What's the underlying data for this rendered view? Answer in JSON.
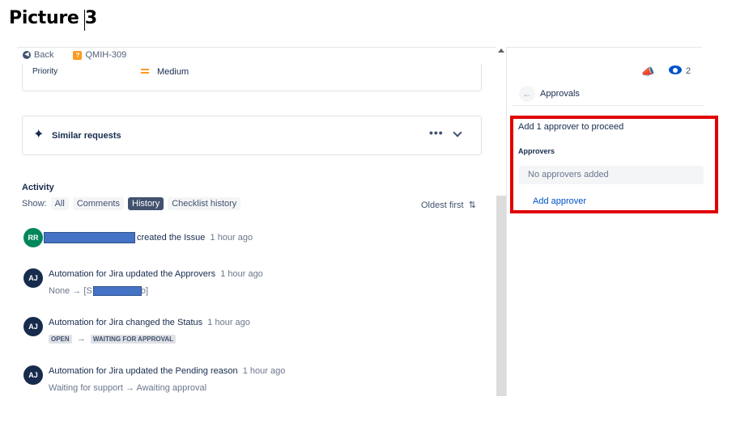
{
  "caption": "Picture 3",
  "breadcrumb": {
    "back_label": "Back",
    "issue_key": "QMIH-309"
  },
  "priority": {
    "label": "Priority",
    "value": "Medium"
  },
  "similar": {
    "label": "Similar requests",
    "more": "•••"
  },
  "activity": {
    "title": "Activity",
    "show_label": "Show:",
    "tabs": [
      "All",
      "Comments",
      "History",
      "Checklist history"
    ],
    "active_tab": "History",
    "sort_label": "Oldest first",
    "entries": [
      {
        "avatar": "RR",
        "text": "created the Issue",
        "time": "1 hour ago"
      },
      {
        "avatar": "AJ",
        "text": "Automation for Jira updated the Approvers",
        "time": "1 hour ago",
        "from": "None",
        "arrow": "→",
        "to_start": "[S",
        "to_end": "o]"
      },
      {
        "avatar": "AJ",
        "text": "Automation for Jira changed the Status",
        "time": "1 hour ago",
        "from": "OPEN",
        "arrow": "→",
        "to": "WAITING FOR APPROVAL"
      },
      {
        "avatar": "AJ",
        "text": "Automation for Jira updated the Pending reason",
        "time": "1 hour ago",
        "from": "Waiting for support",
        "arrow": "→",
        "to": "Awaiting approval"
      }
    ]
  },
  "header_right": {
    "watchers": "2"
  },
  "approvals": {
    "title": "Approvals",
    "proceed_text": "Add 1 approver to proceed",
    "approvers_label": "Approvers",
    "empty_text": "No approvers added",
    "add_label": "Add approver"
  },
  "colors": {
    "highlight": "#e00000",
    "link": "#0052cc",
    "redaction": "#4472c4"
  }
}
